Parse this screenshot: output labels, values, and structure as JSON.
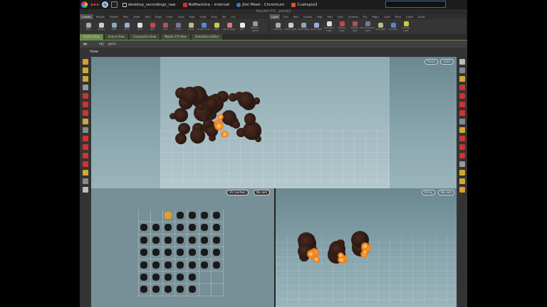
{
  "taskbar": {
    "items": [
      {
        "label": "desktop_recordings_raw",
        "color": "#cccccc"
      },
      {
        "label": "NoMachine - internet",
        "color": "#d03030"
      },
      {
        "label": "Jitsi Meet - Chromium",
        "color": "#3a7ad0"
      },
      {
        "label": "Cuetopia3",
        "color": "#e05030"
      }
    ]
  },
  "window": {
    "title": "Houdini FX - panel2"
  },
  "shelf_left": {
    "tabs": [
      "Create",
      "Modify",
      "Model",
      "Poly",
      "Defo",
      "Text",
      "Rigg",
      "Char",
      "Cons",
      "Hair",
      "Guid",
      "Guis",
      "Ter",
      "Clo"
    ],
    "tools": [
      "Box",
      "Sphere",
      "Tube",
      "Torus",
      "Grid",
      "Null",
      "Line",
      "Circle",
      "Curve",
      "Draw Curve",
      "Path",
      "Spray Paint",
      "Font",
      "Platonic Solids"
    ]
  },
  "shelf_right": {
    "tabs": [
      "Light",
      "Coll",
      "Part",
      "Grains",
      "Rigi",
      "Part",
      "Visc",
      "Oceans",
      "Flu",
      "Popu",
      "Cont",
      "Pyro",
      "Cloth",
      "Solid"
    ],
    "tools": [
      "Camera",
      "Point Light",
      "Spot Light",
      "Area Light",
      "Geometry Light",
      "Volume Light",
      "Distant Light",
      "Environment Light",
      "Sky Light",
      "GI Light",
      "Caustic Light"
    ]
  },
  "pane_tabs": [
    "Scene View",
    "Scene View",
    "Composite View",
    "Motion FX View",
    "Animation Editor"
  ],
  "path": [
    "obj",
    "geo1"
  ],
  "view_label": "View",
  "viewports": {
    "top": {
      "persp": "Persp",
      "cam": "cam1"
    },
    "uv": {
      "mode": "UV (vertex)",
      "cam": "No cam"
    },
    "bottom": {
      "persp": "Persp",
      "cam": "No cam"
    }
  }
}
